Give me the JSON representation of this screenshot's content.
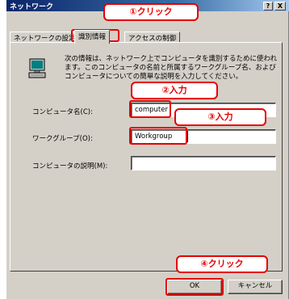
{
  "window": {
    "title": "ネットワーク",
    "help_label": "?",
    "close_label": "X"
  },
  "tabs": [
    {
      "label": "ネットワークの設定"
    },
    {
      "label": "識別情報"
    },
    {
      "label": "アクセスの制御"
    }
  ],
  "description": "次の情報は、ネットワーク上でコンピュータを識別するために使われます。このコンピュータの名前と所属するワークグループ名、およびコンピュータについての簡単な説明を入力してください。",
  "fields": {
    "computer_name": {
      "label": "コンピュータ名(C):",
      "value": "computer"
    },
    "workgroup": {
      "label": "ワークグループ(O):",
      "value": "Workgroup"
    },
    "comment": {
      "label": "コンピュータの説明(M):",
      "value": ""
    }
  },
  "buttons": {
    "ok": "OK",
    "cancel": "キャンセル"
  },
  "callouts": {
    "step1": "①クリック",
    "step2": "②入力",
    "step3": "③入力",
    "step4": "④クリック"
  },
  "colors": {
    "titlebar": "#0a246a",
    "dialog_bg": "#d4d0c8",
    "callout": "#e60000"
  }
}
